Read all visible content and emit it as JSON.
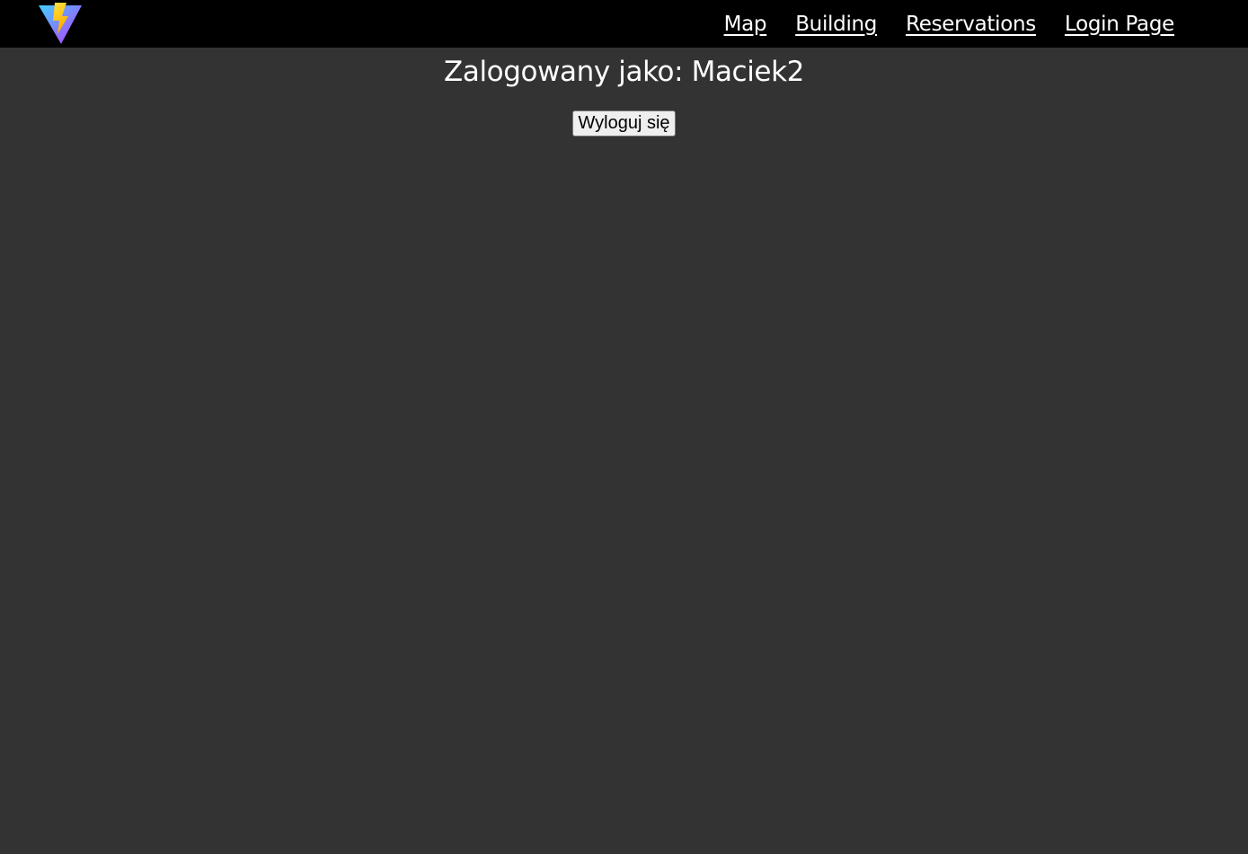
{
  "nav": {
    "logo_icon": "vite-logo-icon",
    "links": [
      {
        "label": "Map"
      },
      {
        "label": "Building"
      },
      {
        "label": "Reservations"
      },
      {
        "label": "Login Page"
      }
    ]
  },
  "main": {
    "title": "Zalogowany jako: Maciek2",
    "logout_label": "Wyloguj się"
  },
  "colors": {
    "navbar_bg": "#000000",
    "page_bg": "#333333",
    "text": "#ffffff"
  }
}
